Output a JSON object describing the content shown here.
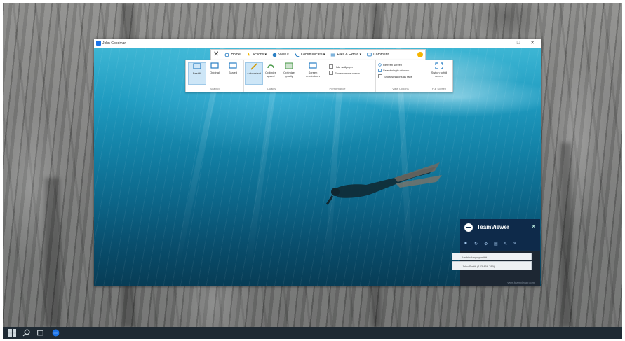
{
  "window": {
    "title": "John Goodman",
    "controls": {
      "minimize": "–",
      "maximize": "□",
      "close": "✕"
    }
  },
  "toolbar": {
    "close_label": "✕",
    "home": "Home",
    "actions": "Actions ▾",
    "view": "View ▾",
    "communicate": "Communicate ▾",
    "files_extras": "Files & Extras ▾",
    "comment": "Comment"
  },
  "ribbon": {
    "scaling": {
      "label": "Scaling",
      "buttons": [
        "Best fit",
        "Original",
        "Scaled"
      ]
    },
    "quality": {
      "label": "Quality",
      "buttons": [
        "Auto select",
        "Optimize speed",
        "Optimize quality"
      ]
    },
    "performance": {
      "label": "Performance",
      "screen_resolution": "Screen resolution ▾",
      "hide_wallpaper": "Hide wallpaper",
      "show_remote_cursor": "Show remote cursor"
    },
    "view_options": {
      "label": "View Options",
      "refresh_screen": "Refresh screen",
      "select_single_window": "Select single window",
      "show_sessions_as_tabs": "Show sessions as tabs"
    },
    "full_screen": {
      "label": "Full Screen",
      "switch": "Switch to full screen"
    }
  },
  "teamviewer": {
    "name": "TeamViewer",
    "close": "✕",
    "row1": "Verbindungsqualität",
    "row2": "John Smith (123 456 789)",
    "footer": "www.teamviewer.com"
  },
  "taskbar": {
    "icons": [
      "windows-start-icon",
      "search-icon",
      "task-view-icon",
      "teamviewer-app-icon"
    ]
  },
  "colors": {
    "ribbon_active": "#cde6f7",
    "teamviewer_navy": "#0e2a4a",
    "taskbar": "#1f2a33"
  }
}
